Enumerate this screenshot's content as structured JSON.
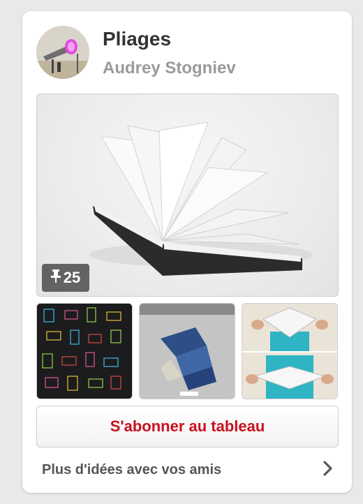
{
  "board": {
    "title": "Pliages",
    "owner": "Audrey Stogniev",
    "pin_count": "25"
  },
  "icons": {
    "pin": "pin-icon",
    "chevron": "chevron-right-icon"
  },
  "actions": {
    "follow_label": "S'abonner au tableau",
    "more_label": "Plus d'idées avec vos amis"
  },
  "colors": {
    "follow_text": "#c8101e",
    "title_text": "#333333",
    "subtitle_text": "#9a9a9a"
  }
}
